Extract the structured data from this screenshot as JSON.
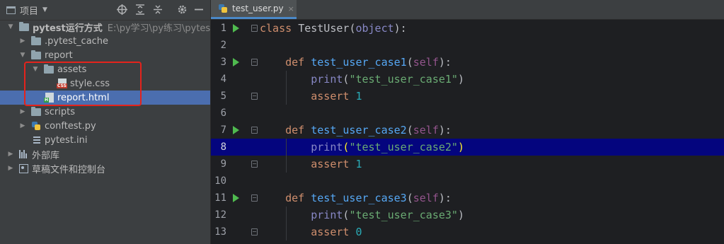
{
  "project_panel": {
    "title": "项目",
    "dropdown_glyph": "▼",
    "tree": [
      {
        "label": "pytest运行方式",
        "path": "E:\\py学习\\py练习\\pytest练习",
        "icon": "folder-icon",
        "expanded": true
      },
      {
        "label": ".pytest_cache",
        "icon": "folder-icon",
        "expanded": false
      },
      {
        "label": "report",
        "icon": "folder-icon",
        "expanded": true
      },
      {
        "label": "assets",
        "icon": "folder-icon",
        "expanded": true
      },
      {
        "label": "style.css",
        "icon": "css-file-icon"
      },
      {
        "label": "report.html",
        "icon": "html-file-icon",
        "selected": true
      },
      {
        "label": "scripts",
        "icon": "folder-icon",
        "expanded": false
      },
      {
        "label": "conftest.py",
        "icon": "python-file-icon",
        "expanded": false
      },
      {
        "label": "pytest.ini",
        "icon": "ini-file-icon"
      },
      {
        "label": "外部库",
        "icon": "library-icon",
        "expanded": false
      },
      {
        "label": "草稿文件和控制台",
        "icon": "console-icon",
        "expanded": false
      }
    ]
  },
  "editor": {
    "tab": {
      "label": "test_user.py",
      "close": "×"
    },
    "current_line": 8,
    "code": [
      {
        "n": "1",
        "text": "class TestUser(object):"
      },
      {
        "n": "2",
        "text": ""
      },
      {
        "n": "3",
        "text": "    def test_user_case1(self):"
      },
      {
        "n": "4",
        "text": "        print(\"test_user_case1\")"
      },
      {
        "n": "5",
        "text": "        assert 1"
      },
      {
        "n": "6",
        "text": ""
      },
      {
        "n": "7",
        "text": "    def test_user_case2(self):"
      },
      {
        "n": "8",
        "text": "        print(\"test_user_case2\")"
      },
      {
        "n": "9",
        "text": "        assert 1"
      },
      {
        "n": "10",
        "text": ""
      },
      {
        "n": "11",
        "text": "    def test_user_case3(self):"
      },
      {
        "n": "12",
        "text": "        print(\"test_user_case3\")"
      },
      {
        "n": "13",
        "text": "        assert 0"
      }
    ]
  },
  "colors": {
    "selection": "#4b6eaf",
    "current_line": "#04057e",
    "highlight_box": "#e4231c",
    "run_gutter": "#4fba4f"
  }
}
